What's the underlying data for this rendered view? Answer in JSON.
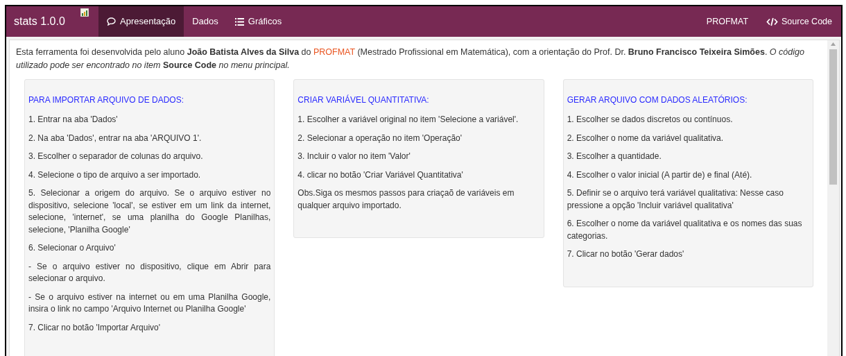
{
  "navbar": {
    "brand": "stats 1.0.0",
    "tabs": [
      {
        "label": "Apresentação",
        "selected": true
      },
      {
        "label": "Dados",
        "selected": false
      },
      {
        "label": "Gráficos",
        "selected": false
      }
    ],
    "right_links": [
      "PROFMAT",
      "Source Code"
    ]
  },
  "intro": {
    "before": "Esta ferramenta foi desenvolvida pelo aluno **João Batista Alves da Silva** do ",
    "link": "PROFMAT",
    "after": " (Mestrado Profissional em Matemática), com a orientação do Prof. Dr. **Bruno Francisco Teixeira Simões**. *O código utilizado pode ser encontrado no item* **Source Code** *no menu principal.*"
  },
  "cards": [
    {
      "title": "PARA IMPORTAR ARQUIVO DE DADOS:",
      "justified": true,
      "items": [
        "1. Entrar na aba 'Dados'",
        "2. Na aba 'Dados', entrar na aba 'ARQUIVO 1'.",
        "3. Escolher o separador de colunas do arquivo.",
        "4. Selecione o tipo de arquivo a ser importado.",
        "5. Selecionar a origem do arquivo. Se o arquivo estiver no dispositivo, selecione 'local', se estiver em um link da internet, selecione, 'internet', se uma planilha do Google Planilhas, selecione, 'Planilha Google'",
        "6. Selecionar o Arquivo'",
        "- Se o arquivo estiver no dispositivo, clique em Abrir para selecionar o arquivo.",
        "- Se o arquivo estiver na internet ou em uma Planilha Google, insira o link no campo 'Arquivo Internet ou Planilha Google'",
        "7. Clicar no botão 'Importar Arquivo'"
      ]
    },
    {
      "title": "CRIAR VARIÁVEL QUANTITATIVA:",
      "justified": false,
      "items": [
        "1. Escolher a variável original no item 'Selecione a variável'.",
        "2. Selecionar a operação no item 'Operação'",
        "3. Incluir o valor no item 'Valor'",
        "4. clicar no botão 'Criar Variável Quantitativa'",
        "Obs.Siga os mesmos passos para criaçaõ de variáveis em qualquer arquivo importado."
      ]
    },
    {
      "title": "GERAR ARQUIVO COM DADOS ALEATÓRIOS:",
      "justified": false,
      "items": [
        "1. Escolher se dados discretos ou contínuos.",
        "2. Escolher o nome da variável qualitativa.",
        "3. Escolher a quantidade.",
        "4. Escolher o valor inicial (A partir de) e final (Até).",
        "5. Definir se o arquivo terá variável qualitativa: Nesse caso pressione a opção 'Incluir variável qualitativa'",
        "6. Escolher o nome da variável qualitativa e os nomes das suas categorias.",
        "7. Clicar no botão 'Gerar dados'"
      ]
    }
  ]
}
